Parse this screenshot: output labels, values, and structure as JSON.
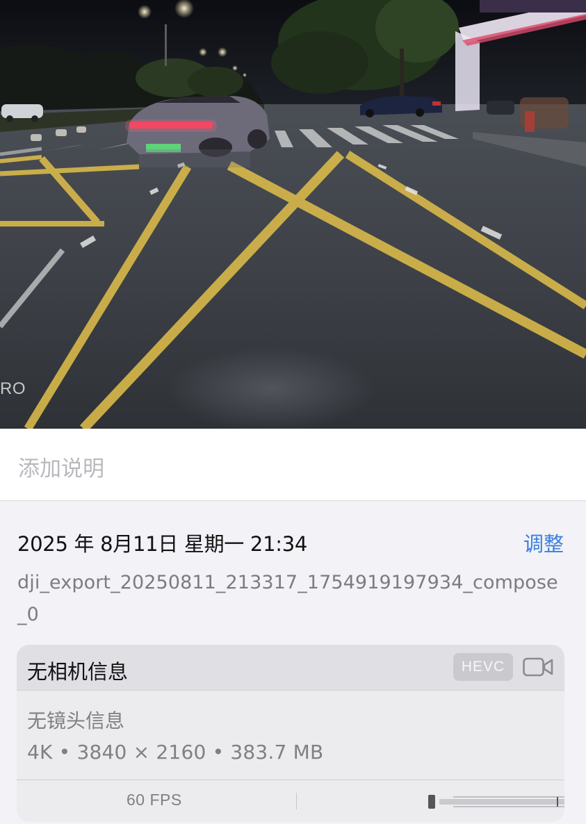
{
  "photo": {
    "watermark": "RO"
  },
  "caption": {
    "placeholder": "添加说明"
  },
  "info": {
    "datetime": "2025 年 8月11日 星期一 21:34",
    "adjust_label": "调整",
    "filename": "dji_export_20250811_213317_1754919197934_compose_0"
  },
  "card": {
    "camera_info": "无相机信息",
    "codec_badge": "HEVC",
    "lens_info": "无镜头信息",
    "specs": "4K • 3840 × 2160 • 383.7 MB",
    "fps": "60 FPS"
  },
  "icons": {
    "video": "video-camera-icon",
    "scrubber": "playback-scrubber-icon"
  },
  "colors": {
    "accent": "#3a7ee0",
    "road_marking": "#d9b94a"
  }
}
